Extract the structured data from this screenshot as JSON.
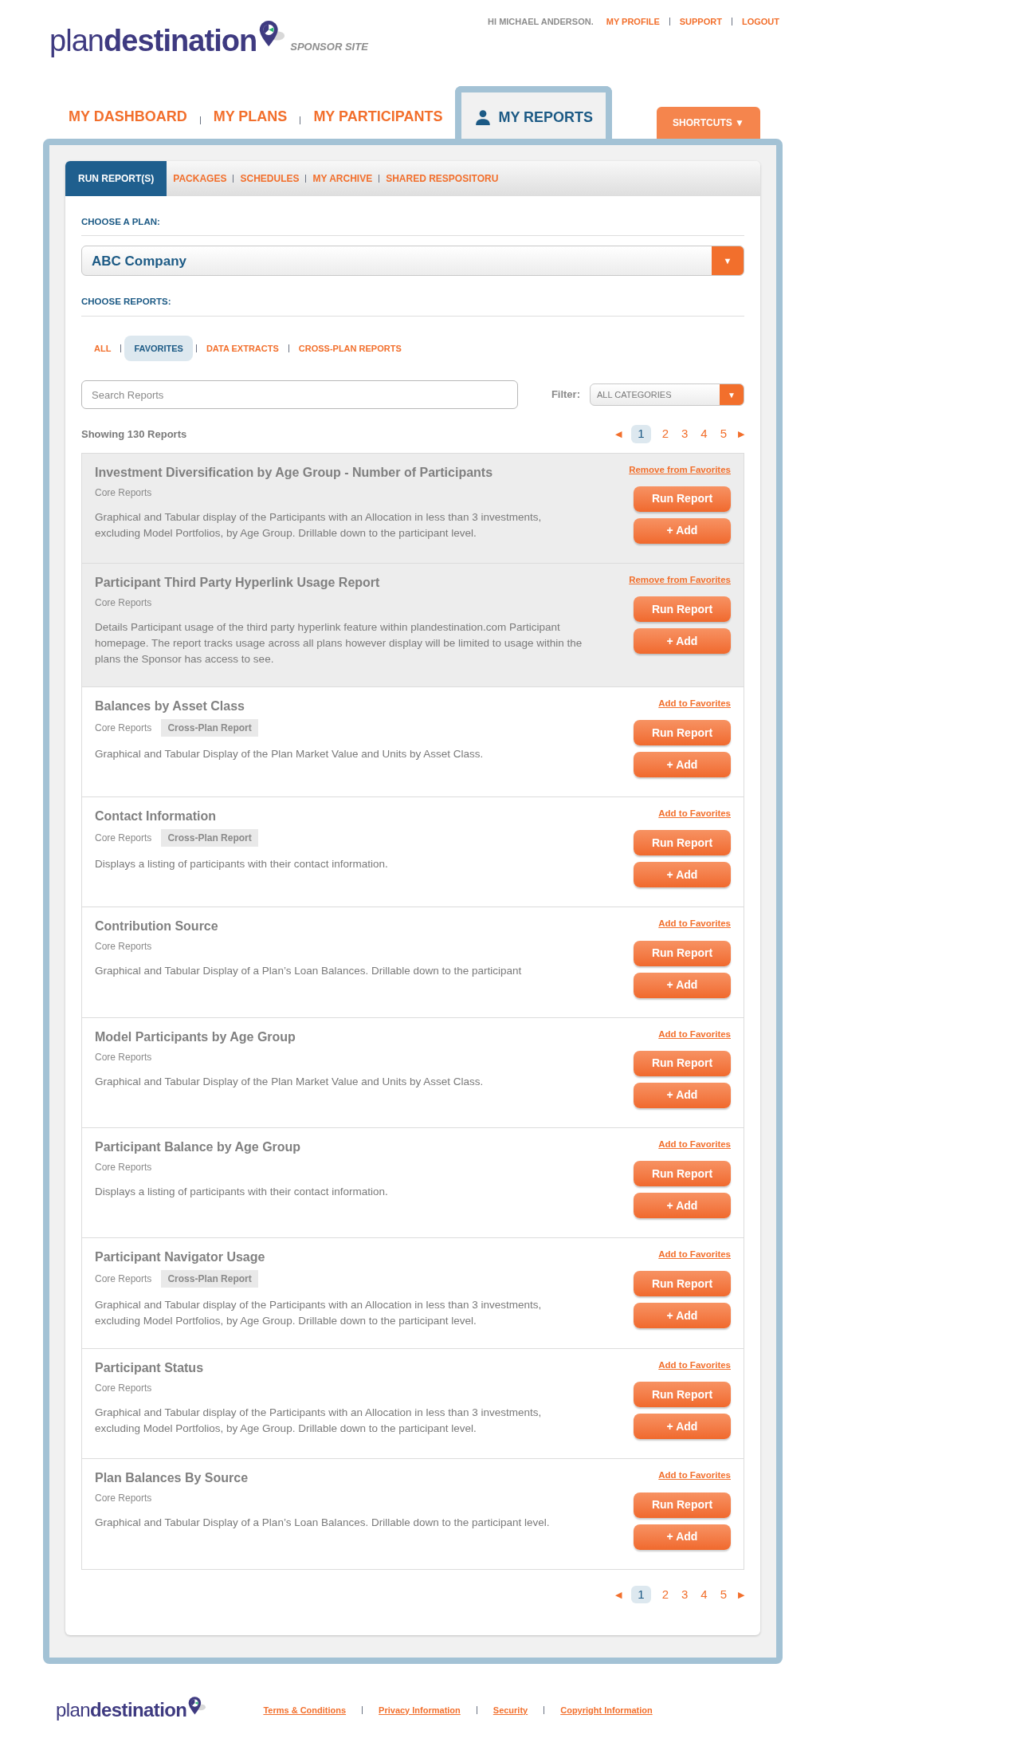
{
  "logo": {
    "text": "plan**destination**",
    "subtitle": "SPONSOR SITE"
  },
  "user_bar": {
    "greeting": "HI MICHAEL ANDERSON.",
    "links": [
      "MY PROFILE",
      "SUPPORT",
      "LOGOUT"
    ]
  },
  "main_tabs": [
    {
      "label": "MY DASHBOARD",
      "selected": false
    },
    {
      "label": "MY PLANS",
      "selected": false
    },
    {
      "label": "MY PARTICIPANTS",
      "selected": false
    },
    {
      "label": "MY REPORTS",
      "selected": true
    }
  ],
  "shortcuts": {
    "label": "SHORTCUTS",
    "arrow": "▼"
  },
  "sub_tabs": [
    {
      "label": "RUN REPORT(S)",
      "selected": true
    },
    {
      "label": "PACKAGES",
      "selected": false
    },
    {
      "label": "SCHEDULES",
      "selected": false
    },
    {
      "label": "MY ARCHIVE",
      "selected": false
    },
    {
      "label": "SHARED RESPOSITORU",
      "selected": false
    }
  ],
  "choose_plan": {
    "label": "CHOOSE A PLAN:",
    "value": "ABC Company",
    "arrow": "▼"
  },
  "choose_reports": {
    "label": "CHOOSE REPORTS:"
  },
  "report_filters": [
    {
      "label": "ALL",
      "selected": false
    },
    {
      "label": "FAVORITES",
      "selected": true
    },
    {
      "label": "DATA EXTRACTS",
      "selected": false
    },
    {
      "label": "CROSS-PLAN REPORTS",
      "selected": false
    }
  ],
  "search": {
    "placeholder": "Search Reports"
  },
  "filter": {
    "label": "Filter:",
    "value": "ALL CATEGORIES",
    "arrow": "▼"
  },
  "showing": "Showing 130 Reports",
  "pagination": {
    "prev": "◀",
    "next": "▶",
    "pages": [
      {
        "label": "1",
        "selected": true
      },
      {
        "label": "2",
        "selected": false
      },
      {
        "label": "3",
        "selected": false
      },
      {
        "label": "4",
        "selected": false
      },
      {
        "label": "5",
        "selected": false
      }
    ]
  },
  "reports": [
    {
      "title": "Investment Diversification by Age Group - Number of Participants",
      "category": "Core Reports",
      "description": "Graphical and Tabular display of the Participants with an Allocation in less than 3 investments, excluding Model Portfolios, by Age Group. Drillable down to the participant level.",
      "favorite": true,
      "favorite_link": "Remove from Favorites",
      "run": "Run Report",
      "add": "+ Add"
    },
    {
      "title": "Participant Third Party Hyperlink Usage Report",
      "category": "Core Reports",
      "description": "Details Participant usage of the third party hyperlink feature within plandestination.com Participant homepage. The report tracks usage across all plans however display will be limited to usage within the plans the Sponsor has access to see.",
      "favorite": true,
      "favorite_link": "Remove from Favorites",
      "run": "Run Report",
      "add": "+ Add"
    },
    {
      "title": "Balances by Asset Class",
      "category": "Core Reports",
      "tag": "Cross-Plan Report",
      "description": "Graphical and Tabular Display of the Plan Market Value and Units by Asset Class.",
      "favorite": false,
      "favorite_link": "Add to Favorites",
      "run": "Run Report",
      "add": "+ Add"
    },
    {
      "title": "Contact Information",
      "category": "Core Reports",
      "tag": "Cross-Plan Report",
      "description": "Displays a listing of participants with their contact information.",
      "favorite": false,
      "favorite_link": "Add to Favorites",
      "run": "Run Report",
      "add": "+ Add"
    },
    {
      "title": "Contribution Source",
      "category": "Core Reports",
      "description": "Graphical and Tabular Display of a Plan’s Loan Balances. Drillable down to the participant",
      "favorite": false,
      "favorite_link": "Add to Favorites",
      "run": "Run Report",
      "add": "+ Add"
    },
    {
      "title": "Model Participants by Age Group",
      "category": "Core Reports",
      "description": "Graphical and Tabular Display of the Plan Market Value and Units by Asset Class.",
      "favorite": false,
      "favorite_link": "Add to Favorites",
      "run": "Run Report",
      "add": "+ Add"
    },
    {
      "title": "Participant Balance by Age Group",
      "category": "Core Reports",
      "description": "Displays a listing of participants with their contact information.",
      "favorite": false,
      "favorite_link": "Add to Favorites",
      "run": "Run Report",
      "add": "+ Add"
    },
    {
      "title": "Participant Navigator Usage",
      "category": "Core Reports",
      "tag": "Cross-Plan Report",
      "description": "Graphical and Tabular display of the Participants with an Allocation in less than 3 investments, excluding Model Portfolios, by Age Group. Drillable down to the participant level.",
      "favorite": false,
      "favorite_link": "Add to Favorites",
      "run": "Run Report",
      "add": "+ Add"
    },
    {
      "title": "Participant Status",
      "category": "Core Reports",
      "description": "Graphical and Tabular display of the Participants with an Allocation in less than 3 investments, excluding Model Portfolios, by Age Group. Drillable down to the participant level.",
      "favorite": false,
      "favorite_link": "Add to Favorites",
      "run": "Run Report",
      "add": "+ Add"
    },
    {
      "title": "Plan Balances By Source",
      "category": "Core Reports",
      "description": "Graphical and Tabular Display of a Plan’s Loan Balances. Drillable down to the participant level.",
      "favorite": false,
      "favorite_link": "Add to Favorites",
      "run": "Run Report",
      "add": "+ Add"
    }
  ],
  "bottom_pagination": {
    "prev": "◀",
    "next": "▶",
    "pages": [
      {
        "label": "1",
        "selected": true
      },
      {
        "label": "2",
        "selected": false
      },
      {
        "label": "3",
        "selected": false
      },
      {
        "label": "4",
        "selected": false
      },
      {
        "label": "5",
        "selected": false
      }
    ]
  },
  "footer": {
    "logo_text": "plan**destination**",
    "links": [
      "Terms & Conditions",
      "Privacy Information",
      "Security",
      "Copyright Information"
    ]
  }
}
